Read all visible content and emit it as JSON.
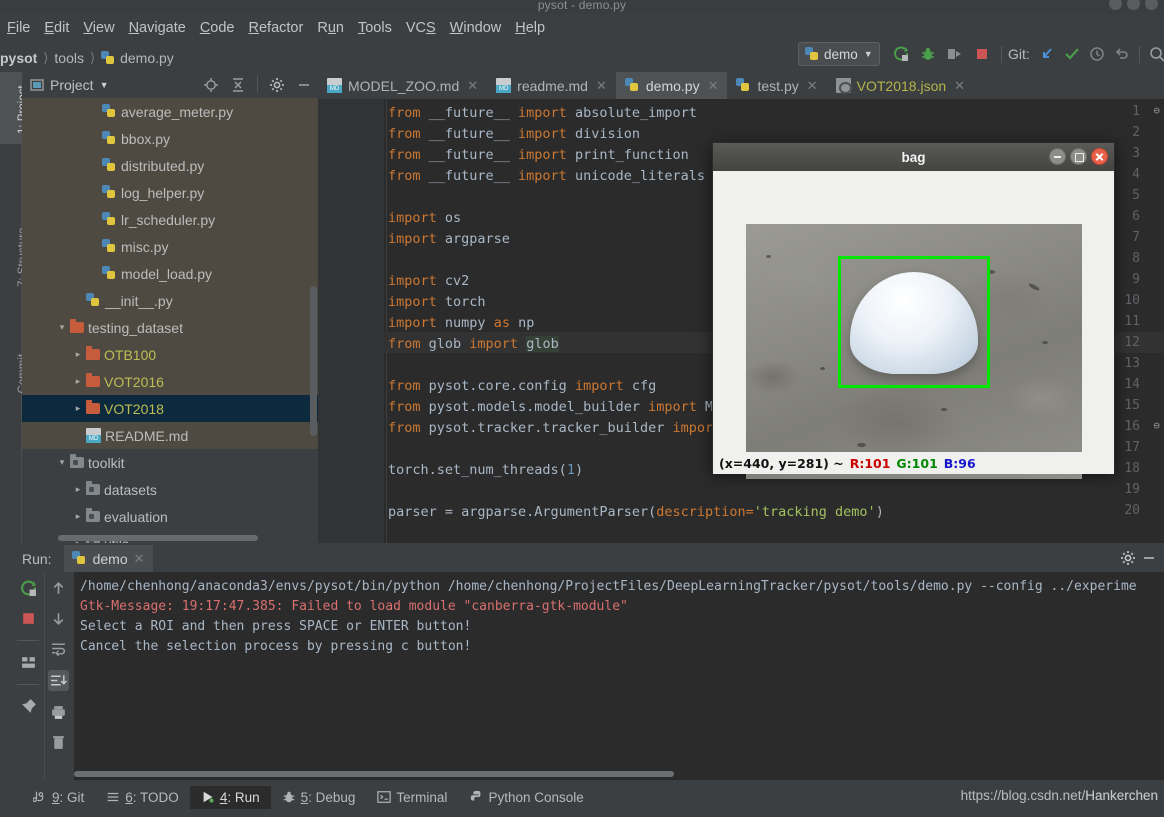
{
  "window": {
    "title": "pysot - demo.py"
  },
  "menu": {
    "items": [
      {
        "label": "File"
      },
      {
        "label": "Edit"
      },
      {
        "label": "View"
      },
      {
        "label": "Navigate"
      },
      {
        "label": "Code"
      },
      {
        "label": "Refactor"
      },
      {
        "label": "Run"
      },
      {
        "label": "Tools"
      },
      {
        "label": "VCS"
      },
      {
        "label": "Window"
      },
      {
        "label": "Help"
      }
    ]
  },
  "breadcrumb": {
    "root": "pysot",
    "folder": "tools",
    "file": "demo.py"
  },
  "toolbar": {
    "run_config": "demo",
    "run_icon": "run-icon",
    "debug_icon": "debug-icon",
    "coverage_icon": "run-coverage-icon",
    "stop_icon": "stop-icon",
    "git_label": "Git:",
    "update_icon": "update-project-icon",
    "commit_icon": "commit-icon",
    "history_icon": "history-icon",
    "rollback_icon": "rollback-icon",
    "search_icon": "search-icon"
  },
  "left_tabs": [
    {
      "label": "1: Project",
      "selected": true
    },
    {
      "label": "7: Structure",
      "selected": false
    },
    {
      "label": "Commit",
      "selected": false
    }
  ],
  "project_panel": {
    "title": "Project",
    "caret": "▾",
    "icons": [
      "locate-icon",
      "collapse-all-icon",
      "settings-icon",
      "hide-icon"
    ],
    "tree": [
      {
        "label": "average_meter.py",
        "icon": "python-file-icon",
        "indent": 4,
        "arrow": "",
        "state": "hl"
      },
      {
        "label": "bbox.py",
        "icon": "python-file-icon",
        "indent": 4,
        "arrow": "",
        "state": "hl"
      },
      {
        "label": "distributed.py",
        "icon": "python-file-icon",
        "indent": 4,
        "arrow": "",
        "state": "hl"
      },
      {
        "label": "log_helper.py",
        "icon": "python-file-icon",
        "indent": 4,
        "arrow": "",
        "state": "hl"
      },
      {
        "label": "lr_scheduler.py",
        "icon": "python-file-icon",
        "indent": 4,
        "arrow": "",
        "state": "hl"
      },
      {
        "label": "misc.py",
        "icon": "python-file-icon",
        "indent": 4,
        "arrow": "",
        "state": "hl"
      },
      {
        "label": "model_load.py",
        "icon": "python-file-icon",
        "indent": 4,
        "arrow": "",
        "state": "hl"
      },
      {
        "label": "__init__.py",
        "icon": "python-file-icon",
        "indent": 3,
        "arrow": "",
        "state": "hl"
      },
      {
        "label": "testing_dataset",
        "icon": "folder-orange-icon",
        "indent": 2,
        "arrow": "▾",
        "state": "hl"
      },
      {
        "label": "OTB100",
        "icon": "folder-orange-icon",
        "indent": 3,
        "arrow": "▸",
        "state": "hl",
        "color": "yellow"
      },
      {
        "label": "VOT2016",
        "icon": "folder-orange-icon",
        "indent": 3,
        "arrow": "▸",
        "state": "hl",
        "color": "yellow"
      },
      {
        "label": "VOT2018",
        "icon": "folder-orange-icon",
        "indent": 3,
        "arrow": "▸",
        "state": "sel",
        "color": "yellow"
      },
      {
        "label": "README.md",
        "icon": "markdown-file-icon",
        "indent": 3,
        "arrow": "",
        "state": "hl"
      },
      {
        "label": "toolkit",
        "icon": "folder-gray-icon",
        "indent": 2,
        "arrow": "▾",
        "state": ""
      },
      {
        "label": "datasets",
        "icon": "folder-gray-icon",
        "indent": 3,
        "arrow": "▸",
        "state": ""
      },
      {
        "label": "evaluation",
        "icon": "folder-gray-icon",
        "indent": 3,
        "arrow": "▸",
        "state": ""
      },
      {
        "label": "utils",
        "icon": "folder-gray-icon",
        "indent": 3,
        "arrow": "▸",
        "state": ""
      }
    ]
  },
  "editor_tabs": [
    {
      "label": "MODEL_ZOO.md",
      "icon": "markdown-file-icon",
      "active": false,
      "color": ""
    },
    {
      "label": "readme.md",
      "icon": "markdown-file-icon",
      "active": false,
      "color": ""
    },
    {
      "label": "demo.py",
      "icon": "python-file-icon",
      "active": true,
      "color": ""
    },
    {
      "label": "test.py",
      "icon": "python-file-icon",
      "active": false,
      "color": ""
    },
    {
      "label": "VOT2018.json",
      "icon": "json-file-icon",
      "active": false,
      "color": "yellow"
    }
  ],
  "editor": {
    "first_line": 1,
    "caret_line": 12,
    "lines": [
      {
        "n": 1,
        "fold": "⊖",
        "tokens": [
          {
            "t": "from ",
            "c": "kw"
          },
          {
            "t": "__future__ ",
            "c": "id"
          },
          {
            "t": "import ",
            "c": "kw"
          },
          {
            "t": "absolute_import",
            "c": "id"
          }
        ]
      },
      {
        "n": 2,
        "fold": "",
        "tokens": [
          {
            "t": "from ",
            "c": "kw"
          },
          {
            "t": "__future__ ",
            "c": "id"
          },
          {
            "t": "import ",
            "c": "kw"
          },
          {
            "t": "division",
            "c": "id"
          }
        ]
      },
      {
        "n": 3,
        "fold": "",
        "tokens": [
          {
            "t": "from ",
            "c": "kw"
          },
          {
            "t": "__future__ ",
            "c": "id"
          },
          {
            "t": "import ",
            "c": "kw"
          },
          {
            "t": "print_function",
            "c": "id"
          }
        ]
      },
      {
        "n": 4,
        "fold": "",
        "tokens": [
          {
            "t": "from ",
            "c": "kw"
          },
          {
            "t": "__future__ ",
            "c": "id"
          },
          {
            "t": "import ",
            "c": "kw"
          },
          {
            "t": "unicode_literals",
            "c": "id"
          }
        ]
      },
      {
        "n": 5,
        "fold": "",
        "tokens": []
      },
      {
        "n": 6,
        "fold": "",
        "tokens": [
          {
            "t": "import ",
            "c": "kw"
          },
          {
            "t": "os",
            "c": "id"
          }
        ]
      },
      {
        "n": 7,
        "fold": "",
        "tokens": [
          {
            "t": "import ",
            "c": "kw"
          },
          {
            "t": "argparse",
            "c": "id"
          }
        ]
      },
      {
        "n": 8,
        "fold": "",
        "tokens": []
      },
      {
        "n": 9,
        "fold": "",
        "tokens": [
          {
            "t": "import ",
            "c": "kw"
          },
          {
            "t": "cv2",
            "c": "id"
          }
        ]
      },
      {
        "n": 10,
        "fold": "",
        "tokens": [
          {
            "t": "import ",
            "c": "kw"
          },
          {
            "t": "torch",
            "c": "id"
          }
        ]
      },
      {
        "n": 11,
        "fold": "",
        "tokens": [
          {
            "t": "import ",
            "c": "kw"
          },
          {
            "t": "numpy ",
            "c": "id"
          },
          {
            "t": "as ",
            "c": "kw"
          },
          {
            "t": "np",
            "c": "id"
          }
        ]
      },
      {
        "n": 12,
        "fold": "",
        "tokens": [
          {
            "t": "from ",
            "c": "kw"
          },
          {
            "t": "glob ",
            "c": "id"
          },
          {
            "t": "import ",
            "c": "kw"
          },
          {
            "t": "glob",
            "c": "hlword"
          }
        ]
      },
      {
        "n": 13,
        "fold": "",
        "tokens": []
      },
      {
        "n": 14,
        "fold": "",
        "tokens": [
          {
            "t": "from ",
            "c": "kw"
          },
          {
            "t": "pysot.core.config ",
            "c": "id"
          },
          {
            "t": "import ",
            "c": "kw"
          },
          {
            "t": "cfg",
            "c": "id"
          }
        ]
      },
      {
        "n": 15,
        "fold": "",
        "tokens": [
          {
            "t": "from ",
            "c": "kw"
          },
          {
            "t": "pysot.models.model_builder ",
            "c": "id"
          },
          {
            "t": "import ",
            "c": "kw"
          },
          {
            "t": "Mo",
            "c": "id"
          }
        ]
      },
      {
        "n": 16,
        "fold": "⊖",
        "tokens": [
          {
            "t": "from ",
            "c": "kw"
          },
          {
            "t": "pysot.tracker.tracker_builder ",
            "c": "id"
          },
          {
            "t": "import",
            "c": "kw"
          }
        ]
      },
      {
        "n": 17,
        "fold": "",
        "tokens": []
      },
      {
        "n": 18,
        "fold": "",
        "tokens": [
          {
            "t": "torch.set_num_threads(",
            "c": "id"
          },
          {
            "t": "1",
            "c": "num"
          },
          {
            "t": ")",
            "c": "id"
          }
        ]
      },
      {
        "n": 19,
        "fold": "",
        "tokens": []
      },
      {
        "n": 20,
        "fold": "",
        "tokens": [
          {
            "t": "parser = argparse.ArgumentParser(",
            "c": "id"
          },
          {
            "t": "description=",
            "c": "kw"
          },
          {
            "t": "'tracking demo'",
            "c": "str"
          },
          {
            "t": ")",
            "c": "id"
          }
        ]
      }
    ]
  },
  "bag_window": {
    "title": "bag",
    "minimize_icon": "minimize-icon",
    "maximize_icon": "maximize-icon",
    "close_icon": "close-icon",
    "bbox_color": "#00e800",
    "status": {
      "coord": "(x=440, y=281) ~",
      "r": "R:101",
      "g": "G:101",
      "b": "B:96"
    }
  },
  "run_panel": {
    "label": "Run:",
    "tab": "demo",
    "tab_icon": "python-file-icon",
    "close_icon": "close-icon",
    "settings_icon": "gear-icon",
    "hide_icon": "hide-icon",
    "side_icons": [
      "rerun-icon",
      "stop-icon",
      "layout-icon",
      "pin-icon"
    ],
    "side_icons_2": [
      "up-arrow-icon",
      "down-arrow-icon",
      "soft-wrap-icon",
      "scroll-to-end-icon",
      "print-icon",
      "trash-icon"
    ],
    "console": [
      {
        "text": "/home/chenhong/anaconda3/envs/pysot/bin/python /home/chenhong/ProjectFiles/DeepLearningTracker/pysot/tools/demo.py --config ../experime",
        "type": "normal"
      },
      {
        "text": "Gtk-Message: 19:17:47.385: Failed to load module \"canberra-gtk-module\"",
        "type": "error"
      },
      {
        "text": "Select a ROI and then press SPACE or ENTER button!",
        "type": "normal"
      },
      {
        "text": "Cancel the selection process by pressing c button!",
        "type": "normal"
      }
    ]
  },
  "status_bar": {
    "items": [
      {
        "label": "9: Git",
        "num": "9",
        "rest": ": Git",
        "icon": "git-icon",
        "active": false
      },
      {
        "label": "6: TODO",
        "num": "6",
        "rest": ": TODO",
        "icon": "todo-icon",
        "active": false
      },
      {
        "label": "4: Run",
        "num": "4",
        "rest": ": Run",
        "icon": "run-icon",
        "active": true
      },
      {
        "label": "5: Debug",
        "num": "5",
        "rest": ": Debug",
        "icon": "debug-icon",
        "active": false
      },
      {
        "label": "Terminal",
        "num": "",
        "rest": "Terminal",
        "icon": "terminal-icon",
        "active": false
      },
      {
        "label": "Python Console",
        "num": "",
        "rest": "Python Console",
        "icon": "python-console-icon",
        "active": false
      }
    ],
    "watermark": "https://blog.csdn.net/Hankerchen",
    "watermark_overlay": "Hankerchen"
  }
}
